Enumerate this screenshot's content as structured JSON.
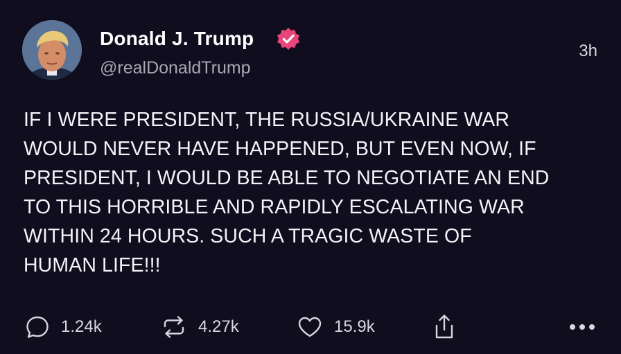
{
  "post": {
    "author": {
      "display_name": "Donald J. Trump",
      "handle": "@realDonaldTrump",
      "verified": true
    },
    "timestamp": "3h",
    "text_lines": [
      "IF I WERE PRESIDENT, THE RUSSIA/UKRAINE WAR",
      "WOULD NEVER HAVE HAPPENED, BUT EVEN NOW, IF",
      "PRESIDENT, I WOULD BE ABLE TO NEGOTIATE AN END",
      "TO THIS HORRIBLE AND RAPIDLY ESCALATING WAR",
      "WITHIN 24 HOURS. SUCH A TRAGIC WASTE OF",
      "HUMAN LIFE!!!"
    ],
    "actions": {
      "comments": "1.24k",
      "reposts": "4.27k",
      "likes": "15.9k"
    }
  },
  "icons": {
    "comment": "comment-bubble-icon",
    "repost": "repost-arrows-icon",
    "like": "heart-icon",
    "share": "share-upload-icon",
    "more": "more-dots-icon",
    "verified": "verified-badge-icon"
  },
  "colors": {
    "background": "#100d1e",
    "text": "#f4f3f8",
    "muted": "#a9a6b6",
    "verified_badge": "#e8457a"
  }
}
